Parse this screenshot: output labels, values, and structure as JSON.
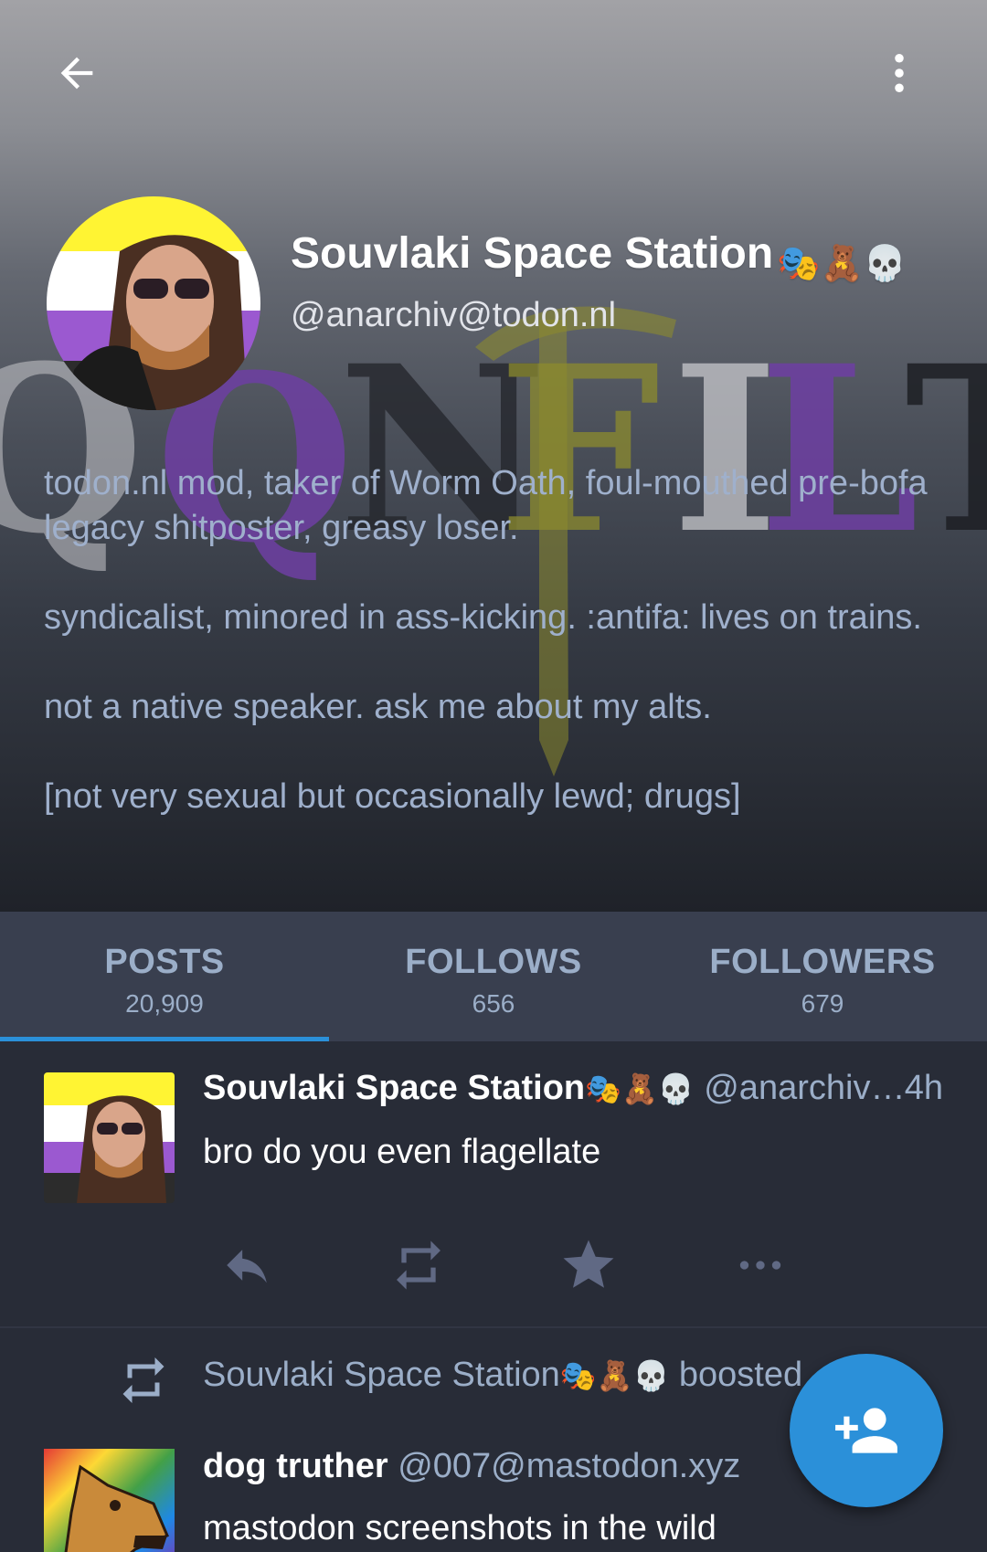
{
  "profile": {
    "display_name": "Souvlaki Space Station",
    "name_suffix": "🎭🧸💀",
    "handle": "@anarchiv@todon.nl",
    "bio": [
      "todon.nl mod, taker of Worm Oath, foul-mouthed pre-bofa legacy shitposter, greasy loser.",
      "syndicalist, minored in ass-kicking. :antifa: lives on trains.",
      "not a native speaker. ask me about my alts.",
      "[not very sexual but occasionally lewd; drugs]"
    ]
  },
  "icons": {
    "back": "arrow-left-icon",
    "more": "more-vertical-icon",
    "reply": "reply-icon",
    "boost": "boost-icon",
    "favourite": "star-icon",
    "more_actions": "more-horizontal-icon",
    "follow": "person-add-icon"
  },
  "stats": {
    "posts": {
      "label": "POSTS",
      "count": "20,909"
    },
    "follows": {
      "label": "FOLLOWS",
      "count": "656"
    },
    "followers": {
      "label": "FOLLOWERS",
      "count": "679"
    }
  },
  "active_tab": "posts",
  "feed": {
    "status1": {
      "name": "Souvlaki Space Station",
      "handle": "@anarchiv…",
      "time": "4h",
      "content": "bro do you even flagellate"
    },
    "boost": {
      "booster_name": "Souvlaki Space Station",
      "suffix": "boosted"
    },
    "status2": {
      "name": "dog truther",
      "handle": "@007@mastodon.xyz",
      "content": "mastodon screenshots in the wild"
    }
  },
  "colors": {
    "accent": "#2b90d9",
    "background": "#282c37",
    "tab_bar": "#393f4f",
    "secondary_text": "#9baec8",
    "bio_text": "#9fb0cc"
  }
}
